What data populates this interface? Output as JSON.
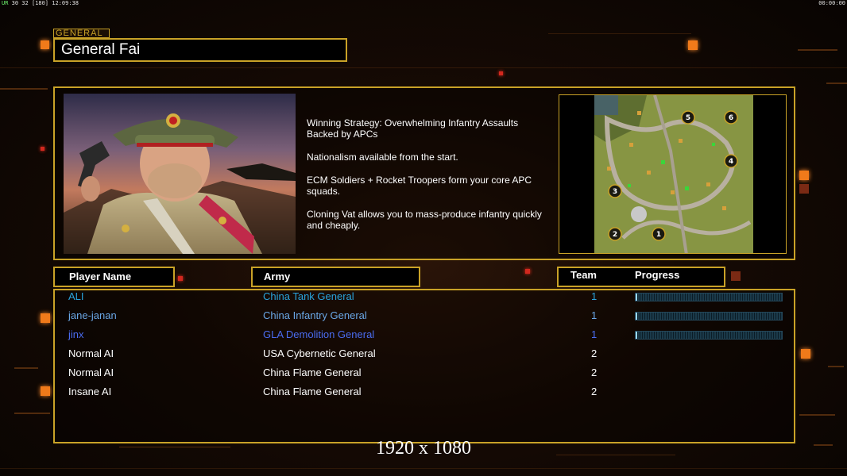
{
  "hud": {
    "top_left_prefix": "UR",
    "top_left_fps": "30 32",
    "top_left_bracket": "[180]",
    "top_left_clock": "12:09:38",
    "top_right_timer": "00:00:00"
  },
  "general": {
    "tag": "GENERAL",
    "name": "General Fai"
  },
  "strategy": [
    "Winning Strategy: Overwhelming Infantry Assaults\n Backed by APCs",
    "Nationalism available from the start.",
    "ECM Soldiers + Rocket Troopers form your core APC\n squads.",
    "Cloning Vat allows you to mass-produce infantry quickly\n and cheaply."
  ],
  "map": {
    "start_positions": [
      "1",
      "2",
      "3",
      "4",
      "5",
      "6"
    ]
  },
  "table": {
    "headers": {
      "player": "Player Name",
      "army": "Army",
      "team": "Team",
      "progress": "Progress"
    },
    "rows": [
      {
        "player": "ALI",
        "army": "China Tank General",
        "team": "1",
        "color": "#29a3dc",
        "progress": 0.01
      },
      {
        "player": "jane-janan",
        "army": "China Infantry General",
        "team": "1",
        "color": "#6aa7e6",
        "progress": 0.01
      },
      {
        "player": "jinx",
        "army": "GLA Demolition General",
        "team": "1",
        "color": "#4a6cf0",
        "progress": 0.01
      },
      {
        "player": "Normal AI",
        "army": "USA Cybernetic General",
        "team": "2",
        "color": "#ffffff",
        "progress": null
      },
      {
        "player": "Normal AI",
        "army": "China Flame General",
        "team": "2",
        "color": "#ffffff",
        "progress": null
      },
      {
        "player": "Insane AI",
        "army": "China Flame General",
        "team": "2",
        "color": "#ffffff",
        "progress": null
      }
    ]
  },
  "overlay_resolution": "1920 x 1080",
  "colors": {
    "accent_gold": "#c9a227",
    "accent_orange": "#f07a1a"
  }
}
